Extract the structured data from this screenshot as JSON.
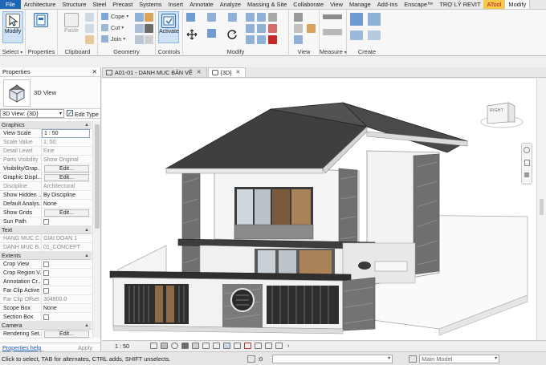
{
  "ribbon_tabs": [
    "File",
    "Architecture",
    "Structure",
    "Steel",
    "Precast",
    "Systems",
    "Insert",
    "Annotate",
    "Analyze",
    "Massing & Site",
    "Collaborate",
    "View",
    "Manage",
    "Add-Ins",
    "Enscape™",
    "TRỢ LÝ REVIT",
    "ATool",
    "Modify"
  ],
  "ribbon": {
    "modify_label": "Modify",
    "properties_label": "Properties",
    "paste_label": "Paste",
    "cope_label": "Cope",
    "cut_label": "Cut",
    "join_label": "Join",
    "activate_label": "Activate",
    "panels": {
      "select": "Select",
      "properties": "Properties",
      "clipboard": "Clipboard",
      "geometry": "Geometry",
      "controls": "Controls",
      "modify": "Modify",
      "view": "View",
      "measure": "Measure",
      "create": "Create"
    }
  },
  "properties_palette": {
    "title": "Properties",
    "close": "✕",
    "type_name": "3D View",
    "instance_filter": "3D View: {3D}",
    "edit_type": "Edit Type",
    "sections": [
      {
        "name": "Graphics",
        "rows": [
          {
            "label": "View Scale",
            "value": "1 : 50",
            "kind": "input"
          },
          {
            "label": "Scale Value",
            "value": "1:  50",
            "kind": "dim"
          },
          {
            "label": "Detail Level",
            "value": "Fine",
            "kind": "dim"
          },
          {
            "label": "Parts Visibility",
            "value": "Show Original",
            "kind": "dim"
          },
          {
            "label": "Visibility/Grap...",
            "value": "Edit...",
            "kind": "button"
          },
          {
            "label": "Graphic Displ...",
            "value": "Edit...",
            "kind": "button"
          },
          {
            "label": "Discipline",
            "value": "Architectural",
            "kind": "dim"
          },
          {
            "label": "Show Hidden ...",
            "value": "By Discipline",
            "kind": "text"
          },
          {
            "label": "Default Analys...",
            "value": "None",
            "kind": "text"
          },
          {
            "label": "Show Grids",
            "value": "Edit...",
            "kind": "button"
          },
          {
            "label": "Sun Path",
            "value": "",
            "kind": "check"
          }
        ]
      },
      {
        "name": "Text",
        "rows": [
          {
            "label": "HANG MUC C...",
            "value": "GIAI DOAN 1",
            "kind": "dim"
          },
          {
            "label": "DANH MUC B...",
            "value": "01_CONCEPT",
            "kind": "dim"
          }
        ]
      },
      {
        "name": "Extents",
        "rows": [
          {
            "label": "Crop View",
            "value": "",
            "kind": "check"
          },
          {
            "label": "Crop Region V...",
            "value": "",
            "kind": "check"
          },
          {
            "label": "Annotation Cr...",
            "value": "",
            "kind": "check"
          },
          {
            "label": "Far Clip Active",
            "value": "",
            "kind": "check"
          },
          {
            "label": "Far Clip Offset",
            "value": "304800.0",
            "kind": "dim"
          },
          {
            "label": "Scope Box",
            "value": "None",
            "kind": "text"
          },
          {
            "label": "Section Box",
            "value": "",
            "kind": "check"
          }
        ]
      },
      {
        "name": "Camera",
        "rows": [
          {
            "label": "Rendering Set...",
            "value": "Edit...",
            "kind": "button"
          }
        ]
      }
    ],
    "help_link": "Properties help",
    "apply": "Apply"
  },
  "view_tabs": [
    {
      "label": "A01-01 - DANH MUC BẢN VẼ",
      "active": false
    },
    {
      "label": "{3D}",
      "active": true
    }
  ],
  "viewcube_face": "RIGHT",
  "view_control": {
    "scale": "1 : 50"
  },
  "status": {
    "message": "Click to select, TAB for alternates, CTRL adds, SHIFT unselects.",
    "zero": ":0",
    "workset": "Main Model"
  },
  "colors": {
    "file_tab": "#1f66b5",
    "atool_tab": "#f7c84a",
    "roof": "#4a4a4a",
    "wall": "#f2f2f2",
    "stone": "#6f6f6f",
    "wood": "#a9825a"
  }
}
